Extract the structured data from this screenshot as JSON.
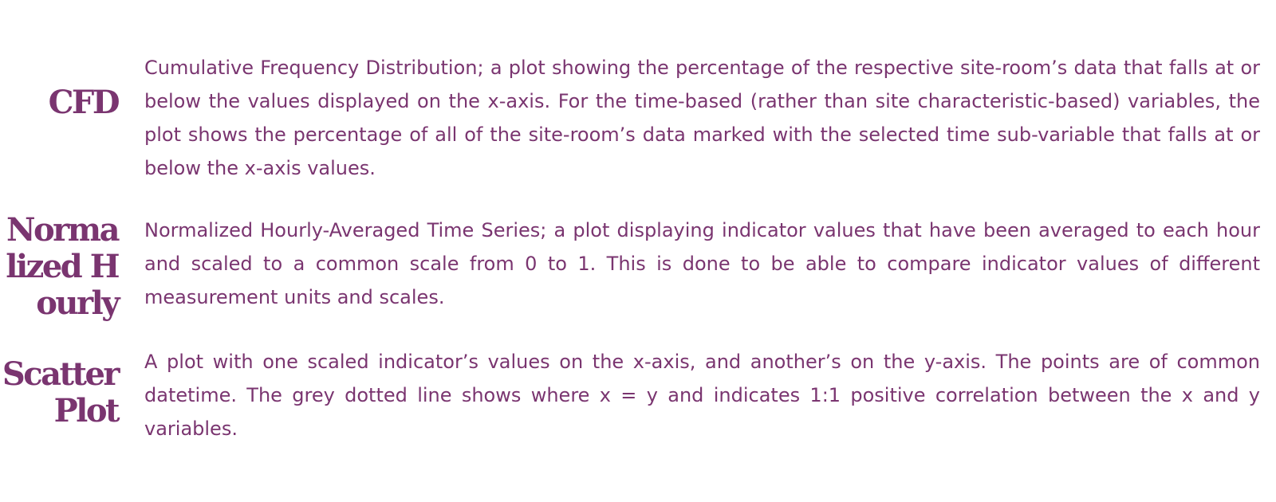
{
  "glossary": [
    {
      "term": "CFD",
      "description": "Cumulative Frequency Distribution; a plot showing the percentage of the respective site-room’s data that falls at or below the values displayed on the x-axis. For the time-based (rather than site characteristic-based) variables, the plot shows the percentage of all of the site-room’s data marked with the selected time sub-variable that falls at or below the x-axis values."
    },
    {
      "term": "Normalized Hourly",
      "description": "Normalized Hourly-Averaged Time Series; a plot displaying indicator values that have been averaged to each hour and scaled to a common scale from 0 to 1. This is done to be able to compare indicator values of different measurement units and scales."
    },
    {
      "term": "Scatter Plot",
      "description": "A plot with one scaled indicator’s values on the x-axis, and another’s on the y-axis. The points are of common datetime. The grey dotted line shows where x = y and indicates 1:1 positive correlation between the x and y variables."
    }
  ],
  "colors": {
    "text": "#7a3570",
    "background": "#ffffff"
  }
}
